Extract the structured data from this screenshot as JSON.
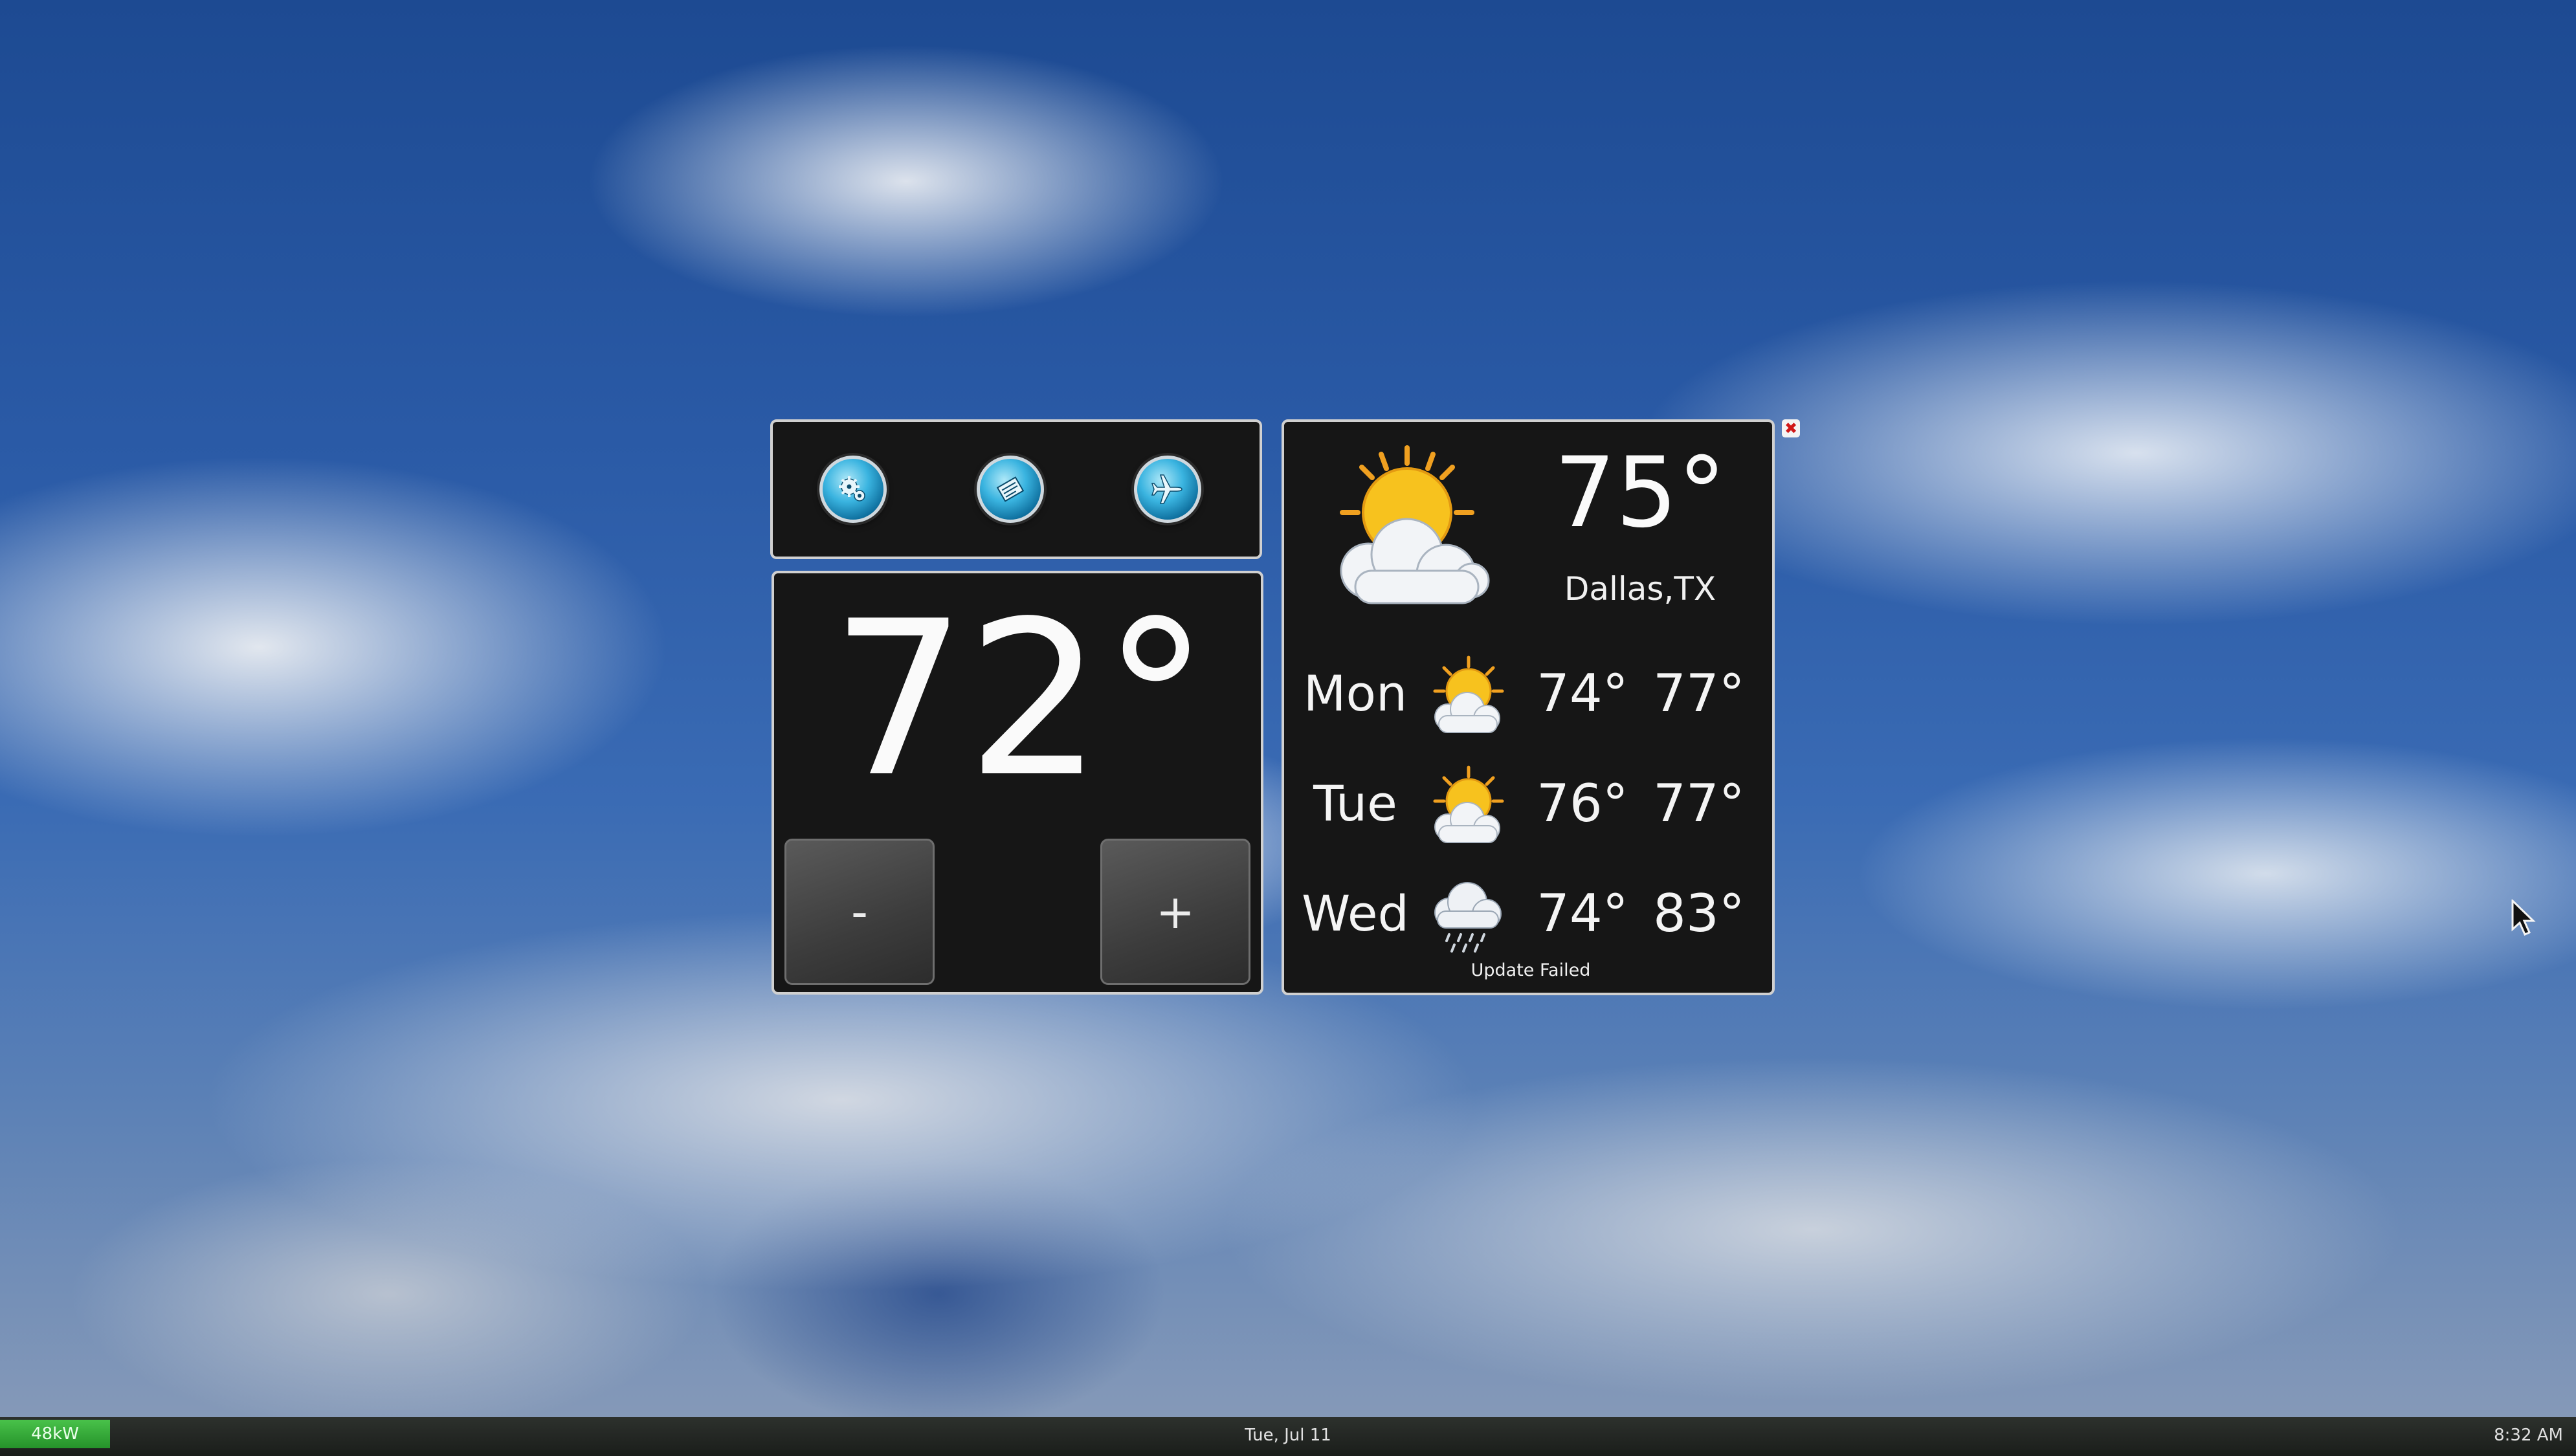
{
  "toolbar": {
    "buttons": [
      {
        "icon": "settings-gear-icon"
      },
      {
        "icon": "notes-icon"
      },
      {
        "icon": "airplane-away-icon"
      }
    ]
  },
  "thermostat": {
    "setpoint": "72°",
    "decrease_label": "-",
    "increase_label": "+"
  },
  "weather": {
    "current_temp": "75°",
    "location": "Dallas,TX",
    "current_icon": "partly-sunny-icon",
    "forecast": [
      {
        "day": "Mon",
        "icon": "partly-sunny-icon",
        "low": "74°",
        "high": "77°"
      },
      {
        "day": "Tue",
        "icon": "partly-sunny-icon",
        "low": "76°",
        "high": "77°"
      },
      {
        "day": "Wed",
        "icon": "rain-cloud-icon",
        "low": "74°",
        "high": "83°"
      }
    ],
    "status": "Update Failed",
    "close_symbol": "✖"
  },
  "taskbar": {
    "power": "48kW",
    "date": "Tue, Jul 11",
    "time": "8:32 AM"
  },
  "colors": {
    "panel_bg": "#161616",
    "panel_border": "#d0d0d0",
    "accent_button": "#3ab4e0",
    "power_indicator": "#2fa533",
    "close_icon": "#d01818"
  }
}
